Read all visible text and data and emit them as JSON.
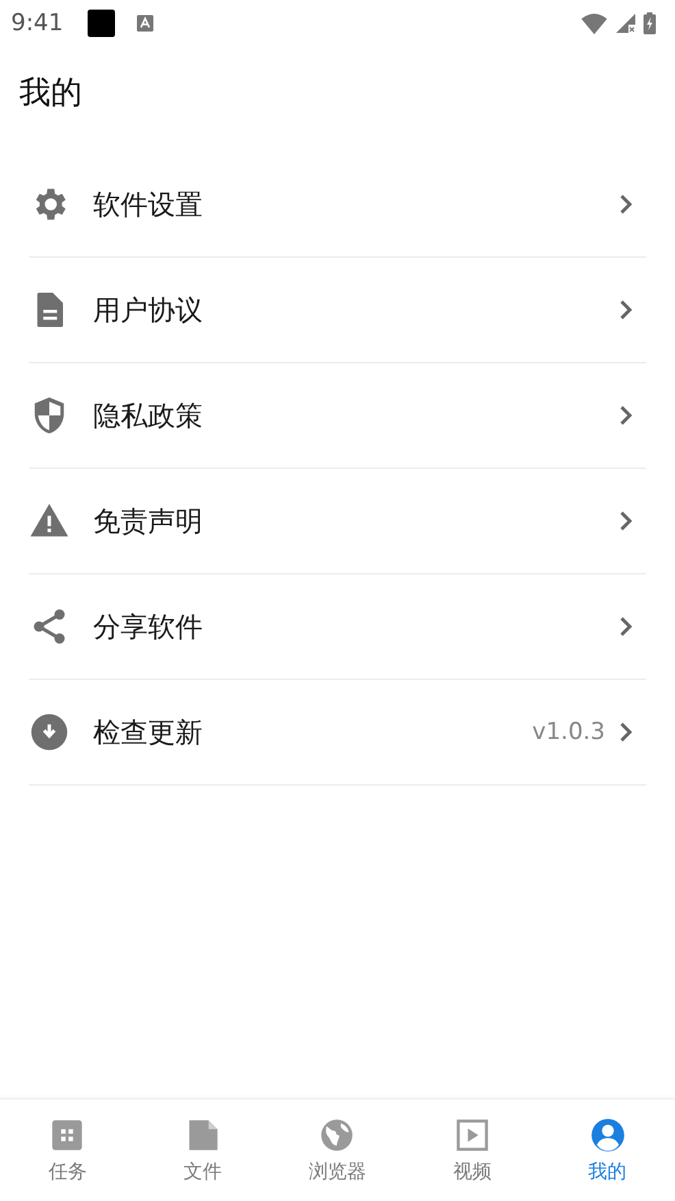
{
  "status_bar": {
    "time": "9:41"
  },
  "header": {
    "title": "我的"
  },
  "menu": [
    {
      "label": "软件设置"
    },
    {
      "label": "用户协议"
    },
    {
      "label": "隐私政策"
    },
    {
      "label": "免责声明"
    },
    {
      "label": "分享软件"
    },
    {
      "label": "检查更新",
      "value": "v1.0.3"
    }
  ],
  "tabs": [
    {
      "label": "任务",
      "selected": false
    },
    {
      "label": "文件",
      "selected": false
    },
    {
      "label": "浏览器",
      "selected": false
    },
    {
      "label": "视频",
      "selected": false
    },
    {
      "label": "我的",
      "selected": true
    }
  ]
}
